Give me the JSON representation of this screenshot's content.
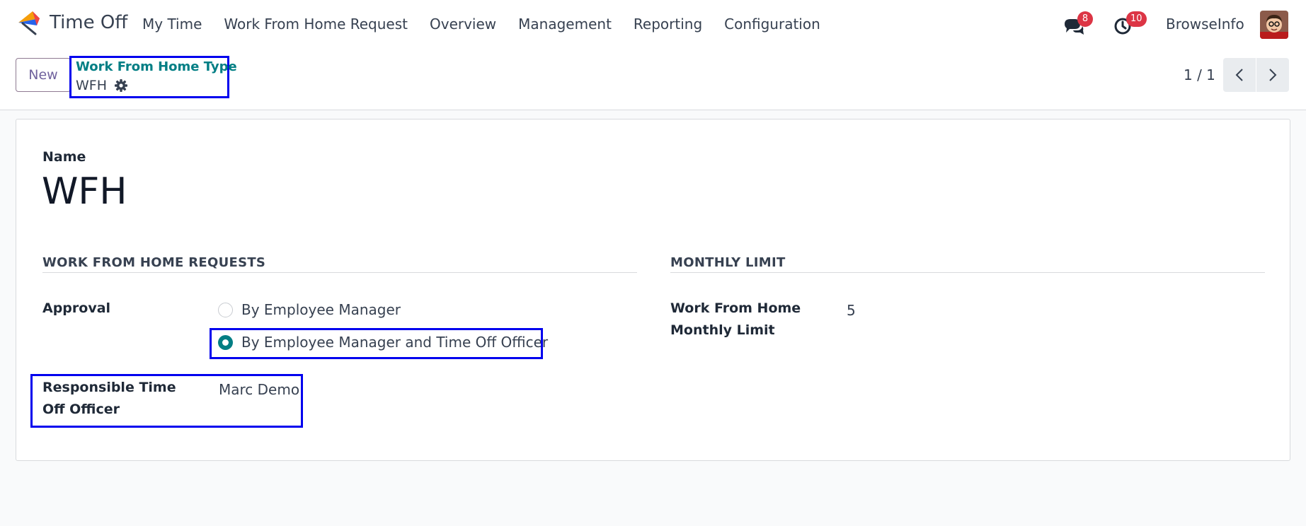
{
  "navbar": {
    "app_name": "Time Off",
    "menu": [
      "My Time",
      "Work From Home Request",
      "Overview",
      "Management",
      "Reporting",
      "Configuration"
    ],
    "chat_badge": "8",
    "activity_badge": "10",
    "user_name": "BrowseInfo",
    "badge_color": "#dc3545"
  },
  "control": {
    "new_label": "New",
    "breadcrumb_parent": "Work From Home Type",
    "breadcrumb_current": "WFH",
    "pager": "1 / 1"
  },
  "form": {
    "name_label": "Name",
    "name_value": "WFH",
    "section_left": "WORK FROM HOME REQUESTS",
    "section_right": "MONTHLY LIMIT",
    "approval_label": "Approval",
    "approval_options": [
      {
        "label": "By Employee Manager",
        "checked": false
      },
      {
        "label": "By Employee Manager and Time Off Officer",
        "checked": true
      }
    ],
    "responsible_label": "Responsible Time Off Officer",
    "responsible_value": "Marc Demo",
    "limit_label": "Work From Home Monthly Limit",
    "limit_value": "5"
  },
  "colors": {
    "accent": "#017e84",
    "highlight": "#0000ee"
  }
}
